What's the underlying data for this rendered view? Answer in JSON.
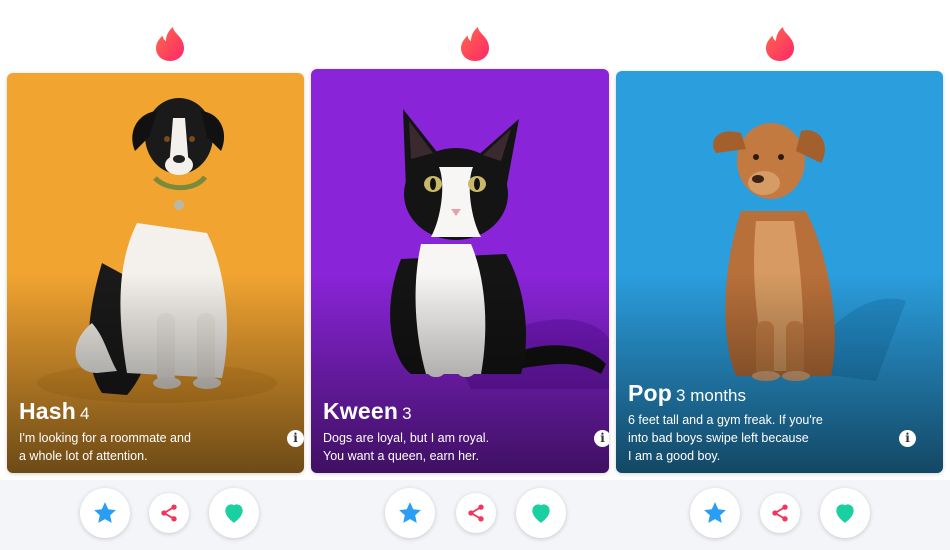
{
  "colors": {
    "brand": "#fd3a61",
    "star": "#2a9df4",
    "share": "#f0365c",
    "like": "#1ad0a0",
    "card1_bg": "#f2a431",
    "card2_bg": "#8a24d9",
    "card3_bg": "#2b9ede"
  },
  "cards": [
    {
      "name": "Hash",
      "age": "4",
      "bio": [
        "I'm looking for a roommate and",
        "a whole lot of attention."
      ],
      "info": "i"
    },
    {
      "name": "Kween",
      "age": "3",
      "bio": [
        "Dogs are loyal, but I am royal.",
        "You want a queen, earn her."
      ],
      "info": "i"
    },
    {
      "name": "Pop",
      "age": "3 months",
      "bio": [
        "6 feet tall and a gym freak. If you're",
        "into bad boys swipe left because",
        "I am a good boy."
      ],
      "info": "i"
    }
  ],
  "icons": {
    "logo": "flame-icon",
    "info": "info-icon",
    "super_like": "star-icon",
    "share": "share-icon",
    "like": "heart-icon"
  }
}
